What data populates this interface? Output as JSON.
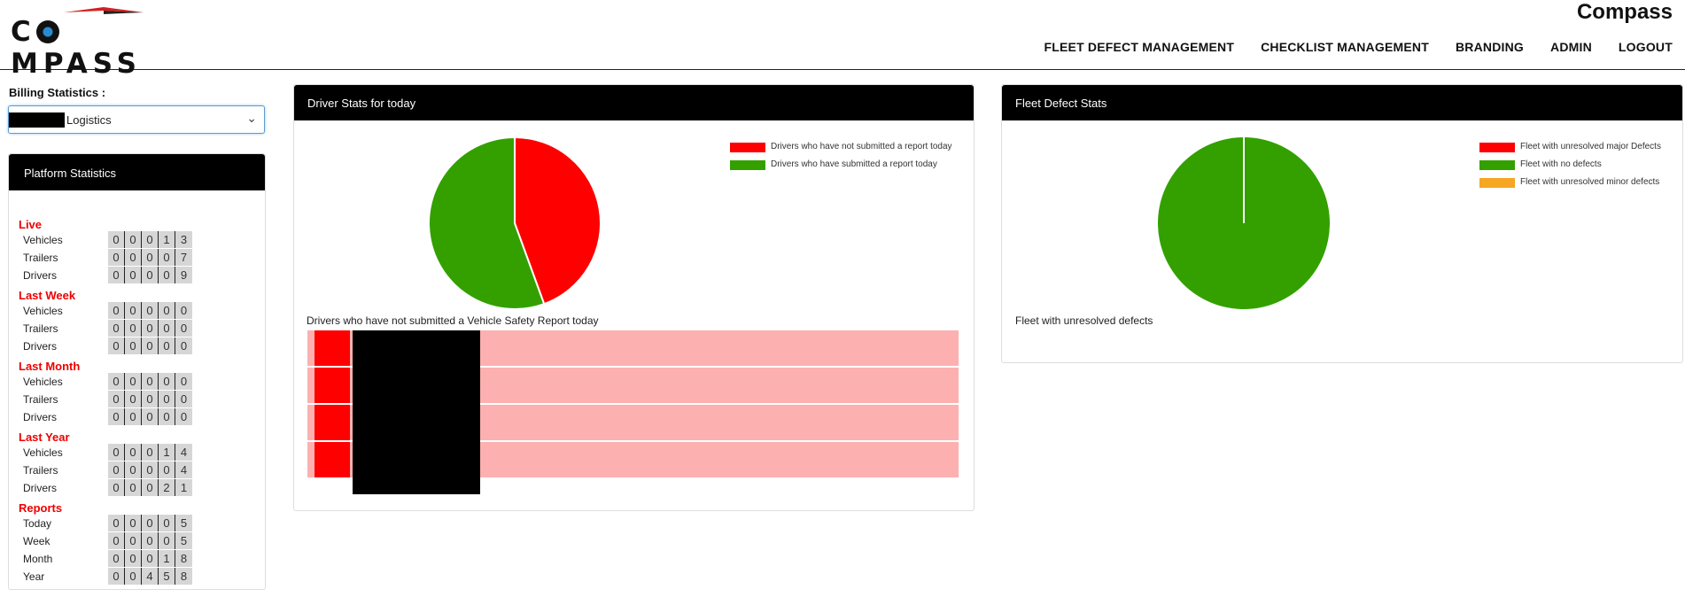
{
  "header": {
    "logo_text": "COMPASS",
    "brand_title": "Compass",
    "nav": [
      {
        "label": "FLEET DEFECT MANAGEMENT"
      },
      {
        "label": "CHECKLIST MANAGEMENT"
      },
      {
        "label": "BRANDING"
      },
      {
        "label": "ADMIN"
      },
      {
        "label": "LOGOUT"
      }
    ]
  },
  "billing": {
    "label": "Billing Statistics :",
    "selected_value": "Logistics",
    "dropdown_icon": "chevron-down-icon"
  },
  "platform": {
    "title": "Platform Statistics",
    "sections": [
      {
        "title": "Live",
        "rows": [
          {
            "label": "Vehicles",
            "digits": [
              "0",
              "0",
              "0",
              "1",
              "3"
            ]
          },
          {
            "label": "Trailers",
            "digits": [
              "0",
              "0",
              "0",
              "0",
              "7"
            ]
          },
          {
            "label": "Drivers",
            "digits": [
              "0",
              "0",
              "0",
              "0",
              "9"
            ]
          }
        ]
      },
      {
        "title": "Last Week",
        "rows": [
          {
            "label": "Vehicles",
            "digits": [
              "0",
              "0",
              "0",
              "0",
              "0"
            ]
          },
          {
            "label": "Trailers",
            "digits": [
              "0",
              "0",
              "0",
              "0",
              "0"
            ]
          },
          {
            "label": "Drivers",
            "digits": [
              "0",
              "0",
              "0",
              "0",
              "0"
            ]
          }
        ]
      },
      {
        "title": "Last Month",
        "rows": [
          {
            "label": "Vehicles",
            "digits": [
              "0",
              "0",
              "0",
              "0",
              "0"
            ]
          },
          {
            "label": "Trailers",
            "digits": [
              "0",
              "0",
              "0",
              "0",
              "0"
            ]
          },
          {
            "label": "Drivers",
            "digits": [
              "0",
              "0",
              "0",
              "0",
              "0"
            ]
          }
        ]
      },
      {
        "title": "Last Year",
        "rows": [
          {
            "label": "Vehicles",
            "digits": [
              "0",
              "0",
              "0",
              "1",
              "4"
            ]
          },
          {
            "label": "Trailers",
            "digits": [
              "0",
              "0",
              "0",
              "0",
              "4"
            ]
          },
          {
            "label": "Drivers",
            "digits": [
              "0",
              "0",
              "0",
              "2",
              "1"
            ]
          }
        ]
      },
      {
        "title": "Reports",
        "rows": [
          {
            "label": "Today",
            "digits": [
              "0",
              "0",
              "0",
              "0",
              "5"
            ]
          },
          {
            "label": "Week",
            "digits": [
              "0",
              "0",
              "0",
              "0",
              "5"
            ]
          },
          {
            "label": "Month",
            "digits": [
              "0",
              "0",
              "0",
              "1",
              "8"
            ]
          },
          {
            "label": "Year",
            "digits": [
              "0",
              "0",
              "4",
              "5",
              "8"
            ]
          }
        ]
      }
    ]
  },
  "driver_panel": {
    "title": "Driver Stats for today",
    "legend": [
      {
        "label": "Drivers who have not submitted a report today",
        "color": "#ff0000"
      },
      {
        "label": "Drivers who have submitted a report today",
        "color": "#33a000"
      }
    ],
    "subtitle": "Drivers who have not submitted a Vehicle Safety Report today",
    "row_count": 4
  },
  "fleet_panel": {
    "title": "Fleet Defect Stats",
    "legend": [
      {
        "label": "Fleet with unresolved major Defects",
        "color": "#ff0000"
      },
      {
        "label": "Fleet with no defects",
        "color": "#33a000"
      },
      {
        "label": "Fleet with unresolved minor defects",
        "color": "#f5a623"
      }
    ],
    "subtitle": "Fleet with unresolved defects"
  },
  "chart_data": [
    {
      "type": "pie",
      "title": "Driver Stats for today",
      "categories": [
        "Drivers who have not submitted a report today",
        "Drivers who have submitted a report today"
      ],
      "values": [
        4,
        5
      ],
      "colors": [
        "#ff0000",
        "#33a000"
      ],
      "legend": "top-right"
    },
    {
      "type": "pie",
      "title": "Fleet Defect Stats",
      "categories": [
        "Fleet with unresolved major Defects",
        "Fleet with no defects",
        "Fleet with unresolved minor defects"
      ],
      "values": [
        0,
        1,
        0
      ],
      "colors": [
        "#ff0000",
        "#33a000",
        "#f5a623"
      ],
      "legend": "top-right"
    }
  ]
}
